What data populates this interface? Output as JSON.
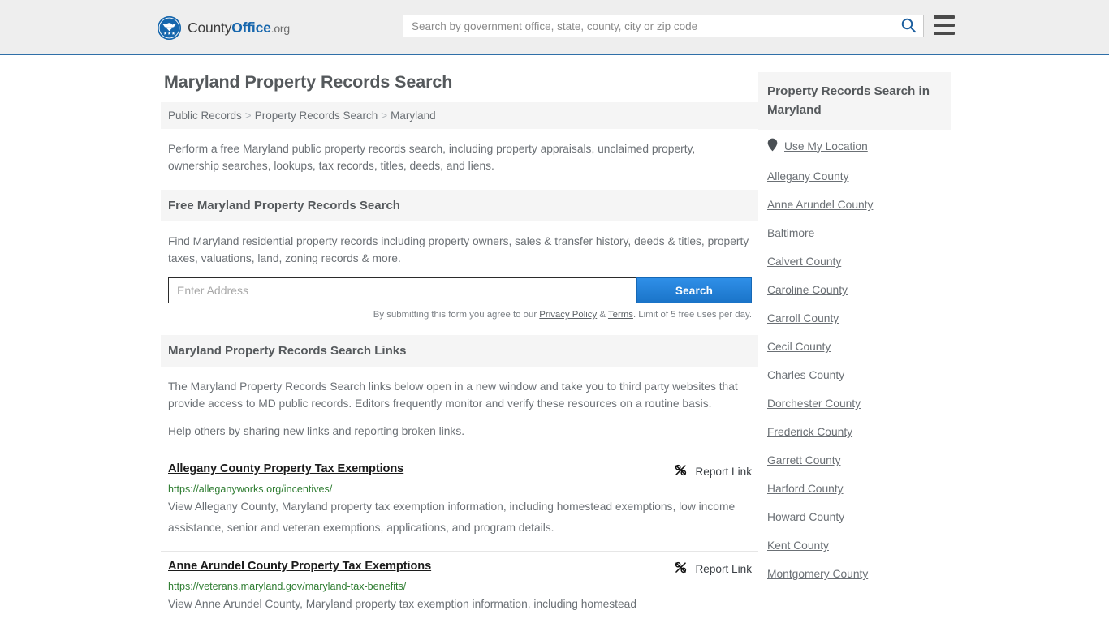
{
  "header": {
    "logo": {
      "part1": "County",
      "part2": "Office",
      "part3": ".org",
      "icon": "eagle-seal-icon"
    },
    "search": {
      "placeholder": "Search by government office, state, county, city or zip code",
      "value": "",
      "icon": "search-icon"
    },
    "menu_icon": "hamburger-menu-icon",
    "accent_color": "#1767ad",
    "background_color": "#eeeeee"
  },
  "page": {
    "title": "Maryland Property Records Search",
    "breadcrumb": [
      {
        "label": "Public Records"
      },
      {
        "label": "Property Records Search"
      },
      {
        "label": "Maryland"
      }
    ],
    "breadcrumb_separator": ">",
    "intro": "Perform a free Maryland public property records search, including property appraisals, unclaimed property, ownership searches, lookups, tax records, titles, deeds, and liens."
  },
  "free_search": {
    "heading": "Free Maryland Property Records Search",
    "description": "Find Maryland residential property records including property owners, sales & transfer history, deeds & titles, property taxes, valuations, land, zoning records & more.",
    "input_placeholder": "Enter Address",
    "input_value": "",
    "button_label": "Search",
    "button_color": "#1a74c8",
    "note_prefix": "By submitting this form you agree to our ",
    "note_privacy": "Privacy Policy",
    "note_amp": " & ",
    "note_terms": "Terms",
    "note_suffix": ". Limit of 5 free uses per day."
  },
  "links_section": {
    "heading": "Maryland Property Records Search Links",
    "paragraph1": "The Maryland Property Records Search links below open in a new window and take you to third party websites that provide access to MD public records. Editors frequently monitor and verify these resources on a routine basis.",
    "help_prefix": "Help others by sharing ",
    "help_link": "new links",
    "help_suffix": " and reporting broken links.",
    "report_label": "Report Link",
    "report_icon": "broken-link-icon",
    "results": [
      {
        "title": "Allegany County Property Tax Exemptions",
        "url": "https://alleganyworks.org/incentives/",
        "description": "View Allegany County, Maryland property tax exemption information, including homestead exemptions, low income assistance, senior and veteran exemptions, applications, and program details."
      },
      {
        "title": "Anne Arundel County Property Tax Exemptions",
        "url": "https://veterans.maryland.gov/maryland-tax-benefits/",
        "description": "View Anne Arundel County, Maryland property tax exemption information, including homestead"
      }
    ]
  },
  "sidebar": {
    "heading": "Property Records Search in Maryland",
    "location_item": {
      "label": "Use My Location",
      "icon": "map-pin-icon"
    },
    "items": [
      {
        "label": "Allegany County"
      },
      {
        "label": "Anne Arundel County"
      },
      {
        "label": "Baltimore"
      },
      {
        "label": "Calvert County"
      },
      {
        "label": "Caroline County"
      },
      {
        "label": "Carroll County"
      },
      {
        "label": "Cecil County"
      },
      {
        "label": "Charles County"
      },
      {
        "label": "Dorchester County"
      },
      {
        "label": "Frederick County"
      },
      {
        "label": "Garrett County"
      },
      {
        "label": "Harford County"
      },
      {
        "label": "Howard County"
      },
      {
        "label": "Kent County"
      },
      {
        "label": "Montgomery County"
      }
    ]
  }
}
